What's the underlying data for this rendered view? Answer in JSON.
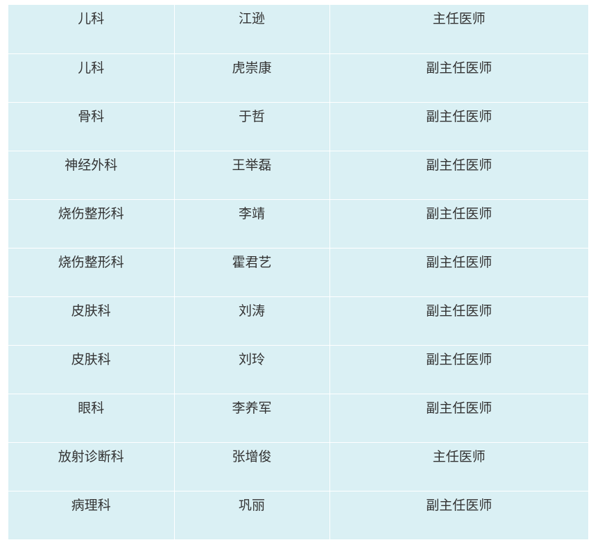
{
  "rows": [
    {
      "department": "儿科",
      "name": "江逊",
      "title": "主任医师"
    },
    {
      "department": "儿科",
      "name": "虎崇康",
      "title": "副主任医师"
    },
    {
      "department": "骨科",
      "name": "于哲",
      "title": "副主任医师"
    },
    {
      "department": "神经外科",
      "name": "王举磊",
      "title": "副主任医师"
    },
    {
      "department": "烧伤整形科",
      "name": "李靖",
      "title": "副主任医师"
    },
    {
      "department": "烧伤整形科",
      "name": "霍君艺",
      "title": "副主任医师"
    },
    {
      "department": "皮肤科",
      "name": "刘涛",
      "title": "副主任医师"
    },
    {
      "department": "皮肤科",
      "name": "刘玲",
      "title": "副主任医师"
    },
    {
      "department": "眼科",
      "name": "李养军",
      "title": "副主任医师"
    },
    {
      "department": "放射诊断科",
      "name": "张增俊",
      "title": "主任医师"
    },
    {
      "department": "病理科",
      "name": "巩丽",
      "title": "副主任医师"
    }
  ]
}
